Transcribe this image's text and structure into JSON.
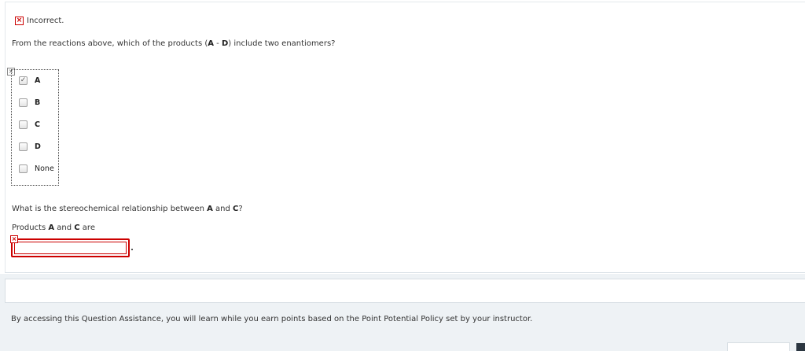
{
  "feedback": {
    "status_text": "Incorrect.",
    "status_icon": "x-icon",
    "status_color": "#cc0000"
  },
  "question1": {
    "text_before": "From the reactions above, which of the products (",
    "bold1": "A",
    "text_mid": " - ",
    "bold2": "D",
    "text_after": ") include two enantiomers?",
    "choices": [
      {
        "label": "A",
        "checked": true
      },
      {
        "label": "B",
        "checked": false
      },
      {
        "label": "C",
        "checked": false
      },
      {
        "label": "D",
        "checked": false
      },
      {
        "label": "None",
        "checked": false
      }
    ]
  },
  "question2": {
    "text_before": "What is the stereochemical relationship between ",
    "bold1": "A",
    "text_mid": " and ",
    "bold2": "C",
    "text_after": "?",
    "answer_prefix_before": "Products ",
    "answer_bold1": "A",
    "answer_mid": " and ",
    "answer_bold2": "C",
    "answer_after": " are",
    "answer_value": ""
  },
  "assistance": {
    "text": "By accessing this Question Assistance, you will learn while you earn points based on the Point Potential Policy set by your instructor."
  }
}
